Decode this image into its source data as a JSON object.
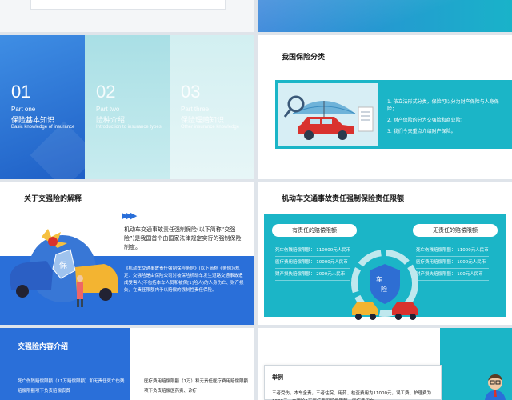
{
  "slide3": {
    "parts": [
      {
        "num": "01",
        "en": "Part one",
        "cn": "保险基本知识",
        "sub": "Basic knowledge of insurance"
      },
      {
        "num": "02",
        "en": "Part two",
        "cn": "险种介绍",
        "sub": "Introduction to insurance types"
      },
      {
        "num": "03",
        "en": "Part three",
        "cn": "保险理赔知识",
        "sub": "Other insurance knowledge"
      }
    ]
  },
  "slide4": {
    "title": "我国保险分类",
    "bullets": [
      "1. 依立法形式分类，保险可以分为财产保险与人身保险；",
      "2. 财产保险的分为交强险和商业险；",
      "3. 我们今天重点介绍财产保险。"
    ]
  },
  "slide5": {
    "title": "关于交强险的解释",
    "para1": "机动车交通事故责任强制保险(以下简称“交强险”)是我国首个由国家法律规定实行的强制保险制度。",
    "para2": "《机动车交通事故责任强制保险条例》(以下简称《条例》)规定：交强险是由保险公司对被保险机动车发生道路交通事故造成受害人(不包括本车人员和被保[1]险人)的人身伤亡、财产损失，在责任限额内予以赔偿的强制性责任保险。",
    "badge": "保"
  },
  "slide6": {
    "title": "机动车交通事故责任强制保险责任限额",
    "left_header": "有责任的赔偿限额",
    "right_header": "无责任的赔偿限额",
    "left_items": [
      "死亡伤残赔偿限额：   110000元人民币",
      "医疗费用赔偿限额：   10000元人民币",
      "财产损失赔偿限额：   2000元人民币"
    ],
    "right_items": [
      "死亡伤残赔偿限额：   11000元人民币",
      "医疗费用赔偿限额：   1000元人民币",
      "财产损失赔偿限额：   100元人民币"
    ],
    "center_text": "车险"
  },
  "slide7": {
    "title": "交强险内容介绍",
    "text1": "死亡伤残赔偿限额（11万赔偿限额）和无责任死亡伤残赔偿限额项下负责赔偿丧葬",
    "text2": "医疗费用赔偿限额（1万）和无责任医疗费用赔偿限额项下负责赔偿医药费、诊疗"
  },
  "slide8": {
    "label": "举例",
    "text": "三者受伤，本车全责，三者住院、用药、检查费用为11000元，误工费、护理费为6000元，交强险1万医疗费用赔偿限额，医疗费用在"
  },
  "colors": {
    "blue": "#2a6fd9",
    "teal": "#1bb5c7",
    "red": "#d9322e"
  }
}
